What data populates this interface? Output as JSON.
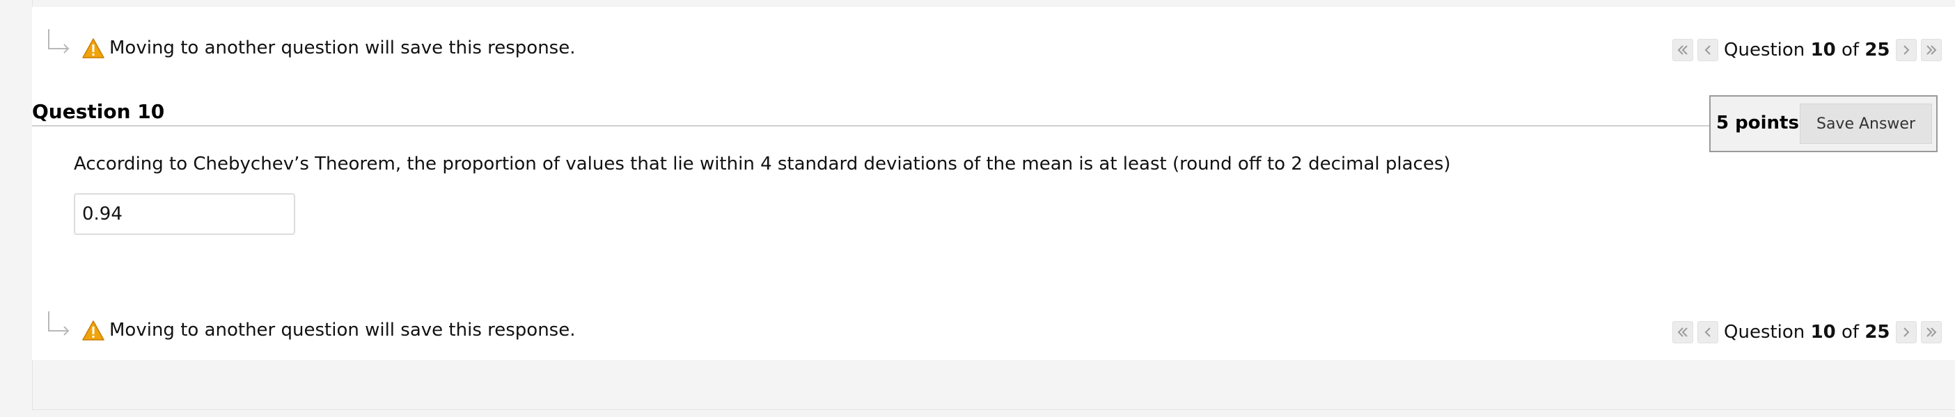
{
  "nav": {
    "notice": "Moving to another question will save this response.",
    "question_word": "Question",
    "current": "10",
    "of_word": "of",
    "total": "25"
  },
  "icons": {
    "flow_arrow": "corner-down-right-arrow-icon",
    "warning": "warning-triangle-icon",
    "first": "double-chevron-left-icon",
    "prev": "chevron-left-icon",
    "next": "chevron-right-icon",
    "last": "double-chevron-right-icon"
  },
  "question": {
    "title": "Question 10",
    "points": "5 points",
    "save_label": "Save Answer",
    "text": "According to Chebychev’s Theorem, the proportion of values that lie within 4 standard deviations of the mean is at least (round off to 2 decimal places)",
    "answer_value": "0.94"
  },
  "colors": {
    "warning_fill": "#f0a30a",
    "page_background": "#f4f4f4",
    "panel_background": "#ffffff"
  }
}
